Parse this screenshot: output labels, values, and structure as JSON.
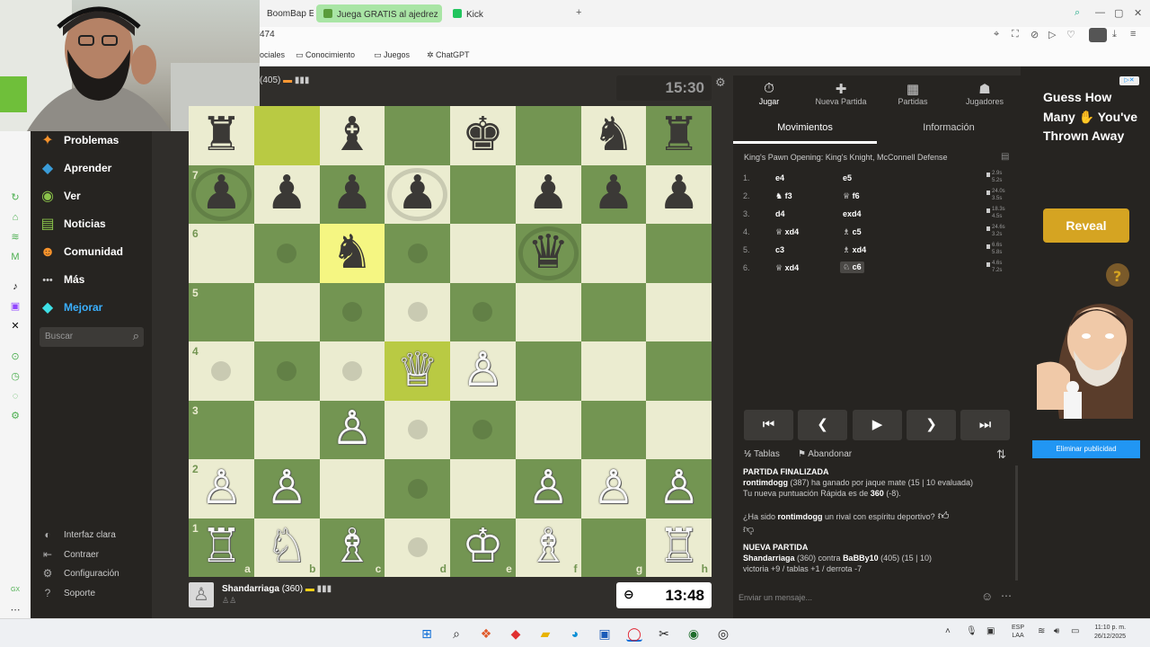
{
  "browser": {
    "tabs": [
      {
        "label": "BoomBap E",
        "active": false
      },
      {
        "label": "Juega GRATIS al ajedrez",
        "active": true
      },
      {
        "label": "Kick",
        "active": false
      }
    ],
    "new_tab": "+",
    "address_text": "474",
    "bookmarks": [
      "ociales",
      "Conocimiento",
      "Juegos",
      "ChatGPT"
    ]
  },
  "sidebar": {
    "items": [
      {
        "label": "Problemas",
        "icon": "puzzle-icon",
        "glyph": "✦",
        "color": "#f7922b"
      },
      {
        "label": "Aprender",
        "icon": "learn-icon",
        "glyph": "◆",
        "color": "#3a9cd8"
      },
      {
        "label": "Ver",
        "icon": "watch-icon",
        "glyph": "◉",
        "color": "#8bc34a"
      },
      {
        "label": "Noticias",
        "icon": "news-icon",
        "glyph": "▤",
        "color": "#8bc34a"
      },
      {
        "label": "Comunidad",
        "icon": "community-icon",
        "glyph": "☻",
        "color": "#f7922b"
      },
      {
        "label": "Más",
        "icon": "more-icon",
        "glyph": "•••",
        "color": "#cccccc"
      },
      {
        "label": "Mejorar",
        "icon": "diamond-icon",
        "glyph": "◆",
        "color": "#3ee0e6"
      }
    ],
    "search_placeholder": "Buscar",
    "bottom_items": [
      {
        "label": "Interfaz clara",
        "icon": "theme-icon",
        "glyph": "◐"
      },
      {
        "label": "Contraer",
        "icon": "collapse-icon",
        "glyph": "⇤"
      },
      {
        "label": "Configuración",
        "icon": "settings-icon",
        "glyph": "⚙"
      },
      {
        "label": "Soporte",
        "icon": "support-icon",
        "glyph": "?"
      }
    ]
  },
  "game": {
    "top_player": {
      "rating": "(405)",
      "clock": "15:30"
    },
    "bottom_player": {
      "name": "Shandarriaga",
      "rating": "(360)",
      "clock": "13:48"
    },
    "board": [
      [
        {
          "p": "♜",
          "c": "b"
        },
        {
          "p": "",
          "c": ""
        },
        {
          "p": "♝",
          "c": "b"
        },
        {
          "p": "",
          "c": ""
        },
        {
          "p": "♚",
          "c": "b"
        },
        {
          "p": "",
          "c": ""
        },
        {
          "p": "♞",
          "c": "b"
        },
        {
          "p": "♜",
          "c": "b"
        }
      ],
      [
        {
          "p": "♟",
          "c": "b",
          "ring": true
        },
        {
          "p": "♟",
          "c": "b"
        },
        {
          "p": "♟",
          "c": "b"
        },
        {
          "p": "♟",
          "c": "b",
          "ring": true
        },
        {
          "p": "",
          "c": ""
        },
        {
          "p": "♟",
          "c": "b"
        },
        {
          "p": "♟",
          "c": "b"
        },
        {
          "p": "♟",
          "c": "b"
        }
      ],
      [
        {
          "p": "",
          "c": ""
        },
        {
          "p": "",
          "c": "",
          "hint": true
        },
        {
          "p": "♞",
          "c": "b",
          "hl": true
        },
        {
          "p": "",
          "c": "",
          "hint": true
        },
        {
          "p": "",
          "c": ""
        },
        {
          "p": "♛",
          "c": "b",
          "ring": true
        },
        {
          "p": "",
          "c": ""
        },
        {
          "p": "",
          "c": ""
        }
      ],
      [
        {
          "p": "",
          "c": ""
        },
        {
          "p": "",
          "c": ""
        },
        {
          "p": "",
          "c": "",
          "hint": true
        },
        {
          "p": "",
          "c": "",
          "hint": true
        },
        {
          "p": "",
          "c": "",
          "hint": true
        },
        {
          "p": "",
          "c": ""
        },
        {
          "p": "",
          "c": ""
        },
        {
          "p": "",
          "c": ""
        }
      ],
      [
        {
          "p": "",
          "c": "",
          "hint": true
        },
        {
          "p": "",
          "c": "",
          "hint": true
        },
        {
          "p": "",
          "c": "",
          "hint": true
        },
        {
          "p": "♕",
          "c": "w",
          "hl": true
        },
        {
          "p": "♙",
          "c": "w"
        },
        {
          "p": "",
          "c": ""
        },
        {
          "p": "",
          "c": ""
        },
        {
          "p": "",
          "c": ""
        }
      ],
      [
        {
          "p": "",
          "c": ""
        },
        {
          "p": "",
          "c": ""
        },
        {
          "p": "♙",
          "c": "w"
        },
        {
          "p": "",
          "c": "",
          "hint": true
        },
        {
          "p": "",
          "c": "",
          "hint": true
        },
        {
          "p": "",
          "c": ""
        },
        {
          "p": "",
          "c": ""
        },
        {
          "p": "",
          "c": ""
        }
      ],
      [
        {
          "p": "♙",
          "c": "w"
        },
        {
          "p": "♙",
          "c": "w"
        },
        {
          "p": "",
          "c": ""
        },
        {
          "p": "",
          "c": "",
          "hint": true
        },
        {
          "p": "",
          "c": ""
        },
        {
          "p": "♙",
          "c": "w"
        },
        {
          "p": "♙",
          "c": "w"
        },
        {
          "p": "♙",
          "c": "w"
        }
      ],
      [
        {
          "p": "♖",
          "c": "w"
        },
        {
          "p": "♘",
          "c": "w"
        },
        {
          "p": "♗",
          "c": "w"
        },
        {
          "p": "",
          "c": "",
          "hint": true
        },
        {
          "p": "♔",
          "c": "w"
        },
        {
          "p": "♗",
          "c": "w"
        },
        {
          "p": "",
          "c": ""
        },
        {
          "p": "♖",
          "c": "w"
        }
      ]
    ],
    "highlight_top_b8": true,
    "ranks": [
      "7",
      "6",
      "5",
      "4",
      "3",
      "2",
      "1"
    ],
    "files": [
      "a",
      "b",
      "c",
      "d",
      "e",
      "f",
      "g",
      "h"
    ]
  },
  "panel": {
    "tabs": [
      {
        "label": "Jugar",
        "glyph": "⏱",
        "icon": "play-clock-icon"
      },
      {
        "label": "Nueva Partida",
        "glyph": "✚",
        "icon": "new-game-icon"
      },
      {
        "label": "Partidas",
        "glyph": "▦",
        "icon": "games-icon"
      },
      {
        "label": "Jugadores",
        "glyph": "☗",
        "icon": "players-icon"
      }
    ],
    "subtabs": [
      "Movimientos",
      "Información"
    ],
    "opening": "King's Pawn Opening: King's Knight, McConnell Defense",
    "moves": [
      {
        "num": "1.",
        "white": "e4",
        "black": "e5",
        "wt": "2.9s",
        "bt": "5.2s"
      },
      {
        "num": "2.",
        "white": "♞ f3",
        "black": "♕ f6",
        "wt": "24.0s",
        "bt": "3.5s"
      },
      {
        "num": "3.",
        "white": "d4",
        "black": "exd4",
        "wt": "18.3s",
        "bt": "4.5s"
      },
      {
        "num": "4.",
        "white": "♕ xd4",
        "black": "♗ c5",
        "wt": "24.6s",
        "bt": "3.2s"
      },
      {
        "num": "5.",
        "white": "c3",
        "black": "♗ xd4",
        "wt": "6.6s",
        "bt": "5.8s"
      },
      {
        "num": "6.",
        "white": "♕ xd4",
        "black": "♘ c6",
        "wt": "4.6s",
        "bt": "7.2s"
      }
    ],
    "actions": {
      "draw": "Tablas",
      "resign": "Abandonar"
    },
    "chat": {
      "finished": "PARTIDA FINALIZADA",
      "winner_name": "rontimdogg",
      "winner_text": " (387) ha ganado por jaque mate (15 | 10 evaluada)",
      "rating_prefix": "Tu nueva puntuación Rápida es de ",
      "rating_value": "360",
      "rating_suffix": " (-8).",
      "sport_prefix": "¿Ha sido ",
      "sport_name": "rontimdogg",
      "sport_suffix": " un rival con espíritu deportivo?",
      "new_game": "NUEVA PARTIDA",
      "matchup_a": "Shandarriaga",
      "matchup_mid": " (360) contra ",
      "matchup_b": "BaBBy10",
      "matchup_tail": " (405) (15 | 10)",
      "record": "victoria +9 / tablas +1 / derrota -7",
      "input_placeholder": "Enviar un mensaje..."
    }
  },
  "ad": {
    "headline": "Guess How Many ✋ You've Thrown Away",
    "button": "Reveal",
    "remove": "Eliminar publicidad"
  },
  "taskbar": {
    "lang_top": "ESP",
    "lang_bottom": "LAA",
    "time": "11:10 p. m.",
    "date": "26/12/2025"
  }
}
